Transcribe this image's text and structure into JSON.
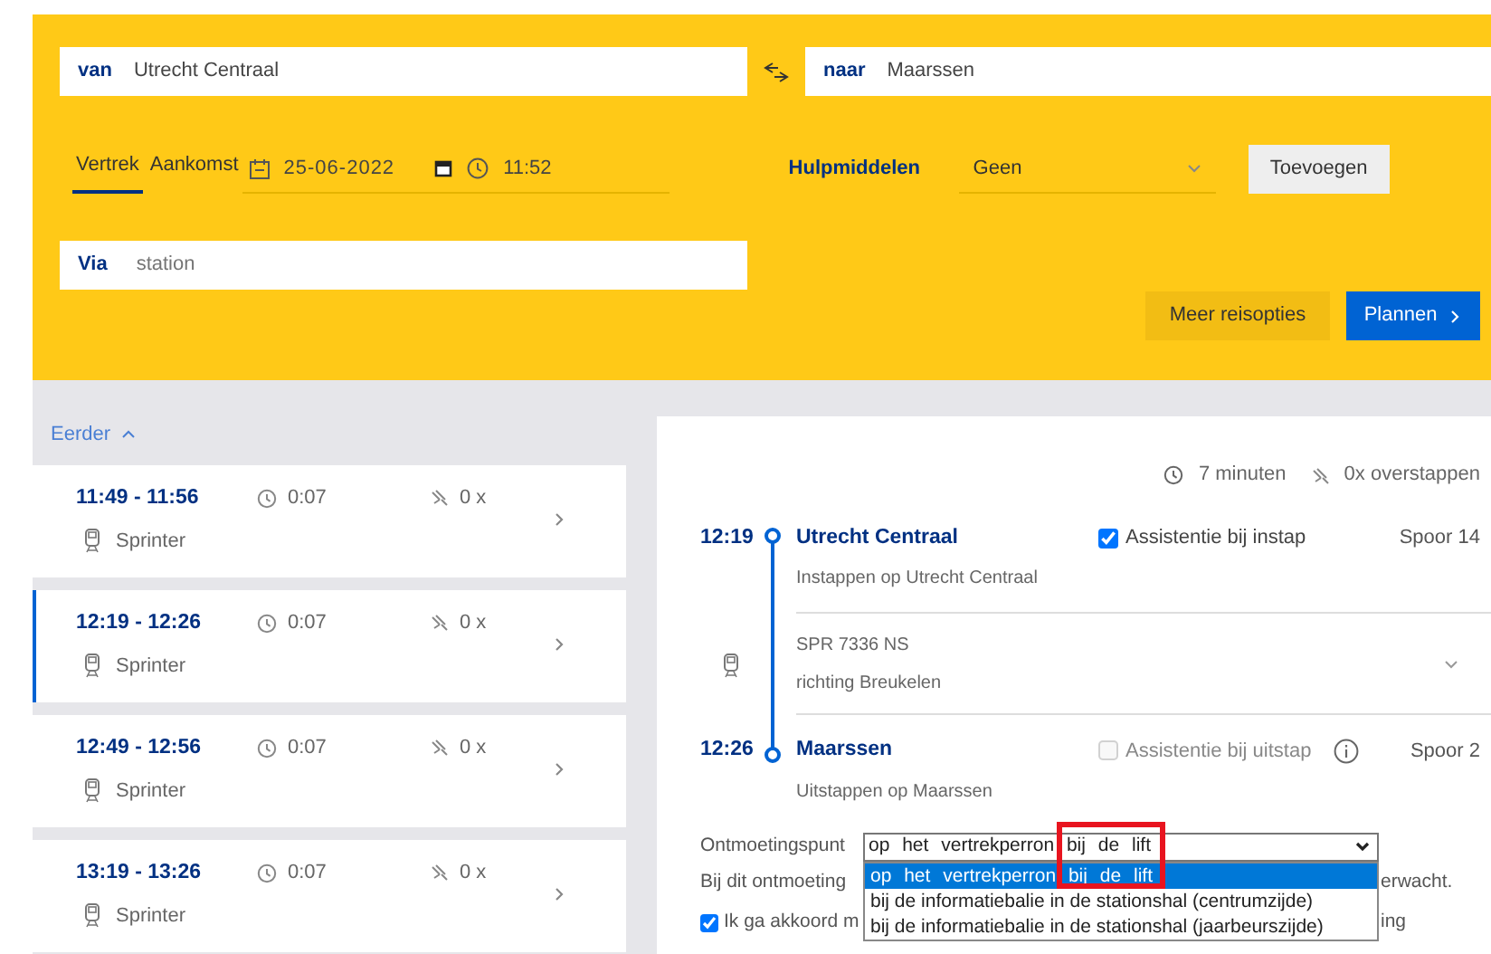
{
  "search": {
    "from": {
      "label": "van",
      "value": "Utrecht Centraal"
    },
    "to": {
      "label": "naar",
      "value": "Maarssen"
    },
    "time_tabs": [
      {
        "label": "Vertrek",
        "selected": true
      },
      {
        "label": "Aankomst",
        "selected": false
      }
    ],
    "date": "25-06-2022",
    "time": "11:52",
    "aids": {
      "label": "Hulpmiddelen",
      "value": "Geen",
      "add_button": "Toevoegen"
    },
    "via": {
      "label": "Via",
      "placeholder": "station"
    },
    "buttons": [
      {
        "label": "Meer reisopties",
        "kind": "secondary"
      },
      {
        "label": "Plannen",
        "kind": "primary"
      }
    ]
  },
  "results": {
    "earlier": "Eerder",
    "trips": [
      {
        "times": "11:49 - 11:56",
        "duration": "0:07",
        "transfers": "0 x",
        "type": "Sprinter",
        "selected": false
      },
      {
        "times": "12:19 - 12:26",
        "duration": "0:07",
        "transfers": "0 x",
        "type": "Sprinter",
        "selected": true
      },
      {
        "times": "12:49 - 12:56",
        "duration": "0:07",
        "transfers": "0 x",
        "type": "Sprinter",
        "selected": false
      },
      {
        "times": "13:19 - 13:26",
        "duration": "0:07",
        "transfers": "0 x",
        "type": "Sprinter",
        "selected": false
      }
    ]
  },
  "detail": {
    "duration": "7 minuten",
    "transfers": "0x overstappen",
    "stops": [
      {
        "time": "12:19",
        "name": "Utrecht Centraal",
        "note": "Instappen op Utrecht Centraal",
        "assist_label": "Assistentie bij instap",
        "assist_checked": true,
        "assist_disabled": false,
        "info": false,
        "platform": "Spoor 14"
      },
      {
        "time": "12:26",
        "name": "Maarssen",
        "note": "Uitstappen op Maarssen",
        "assist_label": "Assistentie bij uitstap",
        "assist_checked": false,
        "assist_disabled": true,
        "info": true,
        "platform": "Spoor 2"
      }
    ],
    "ride": {
      "train": "SPR 7336 NS",
      "direction": "richting Breukelen"
    },
    "meeting": {
      "label": "Ontmoetingspunt",
      "value": "op het vertrekperron bij de lift",
      "options": [
        {
          "label": "op het vertrekperron bij de lift",
          "selected": true
        },
        {
          "label": "bij de informatiebalie in de stationshal (centrumzijde)",
          "selected": false
        },
        {
          "label": "bij de informatiebalie in de stationshal (jaarbeurszijde)",
          "selected": false
        }
      ]
    },
    "note_start": "Bij dit ontmoeting",
    "note_end": "erwacht.",
    "agree": {
      "checked": true,
      "text_start": "Ik ga akkoord m",
      "text_end": "ing"
    }
  }
}
